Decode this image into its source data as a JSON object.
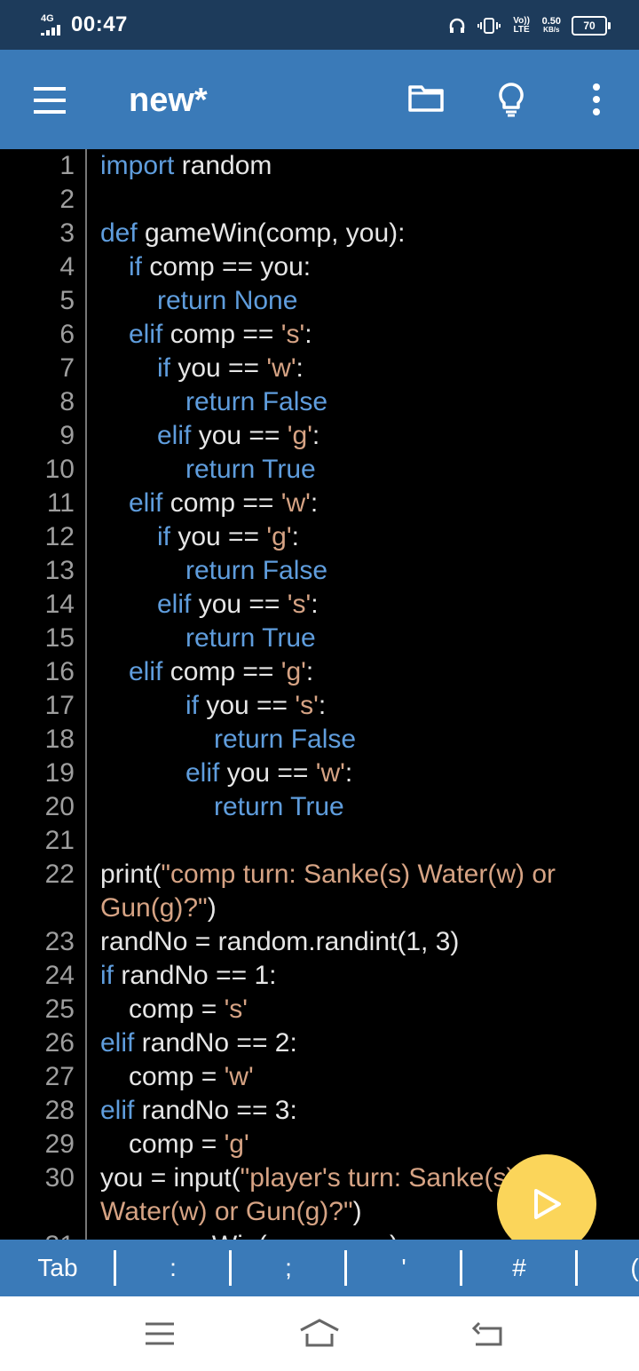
{
  "status": {
    "network_label": "4G",
    "time": "00:47",
    "volte": "Vo)) LTE",
    "speed_value": "0.50",
    "speed_unit": "KB/s",
    "battery": "70"
  },
  "app": {
    "title": "new*",
    "menu_icon": "hamburger-menu-icon",
    "open_icon": "folder-icon",
    "tip_icon": "lightbulb-icon",
    "more_icon": "more-vert-icon"
  },
  "editor": {
    "lines": [
      {
        "n": "1",
        "indent": 0,
        "tokens": [
          {
            "t": "import",
            "c": "kw"
          },
          {
            "t": " random",
            "c": ""
          }
        ]
      },
      {
        "n": "2",
        "indent": 0,
        "tokens": []
      },
      {
        "n": "3",
        "indent": 0,
        "tokens": [
          {
            "t": "def",
            "c": "kw"
          },
          {
            "t": " gameWin(comp, you):",
            "c": ""
          }
        ]
      },
      {
        "n": "4",
        "indent": 1,
        "tokens": [
          {
            "t": "if",
            "c": "kw"
          },
          {
            "t": " comp == you:",
            "c": ""
          }
        ]
      },
      {
        "n": "5",
        "indent": 2,
        "tokens": [
          {
            "t": "return None",
            "c": "kw"
          }
        ]
      },
      {
        "n": "6",
        "indent": 1,
        "tokens": [
          {
            "t": "elif",
            "c": "kw"
          },
          {
            "t": " comp == ",
            "c": ""
          },
          {
            "t": "'s'",
            "c": "str"
          },
          {
            "t": ":",
            "c": ""
          }
        ]
      },
      {
        "n": "7",
        "indent": 2,
        "tokens": [
          {
            "t": "if",
            "c": "kw"
          },
          {
            "t": " you == ",
            "c": ""
          },
          {
            "t": "'w'",
            "c": "str"
          },
          {
            "t": ":",
            "c": ""
          }
        ]
      },
      {
        "n": "8",
        "indent": 3,
        "tokens": [
          {
            "t": "return False",
            "c": "kw"
          }
        ]
      },
      {
        "n": "9",
        "indent": 2,
        "tokens": [
          {
            "t": "elif",
            "c": "kw"
          },
          {
            "t": " you == ",
            "c": ""
          },
          {
            "t": "'g'",
            "c": "str"
          },
          {
            "t": ":",
            "c": ""
          }
        ]
      },
      {
        "n": "10",
        "indent": 3,
        "tokens": [
          {
            "t": "return True",
            "c": "kw"
          }
        ]
      },
      {
        "n": "11",
        "indent": 1,
        "tokens": [
          {
            "t": "elif",
            "c": "kw"
          },
          {
            "t": " comp == ",
            "c": ""
          },
          {
            "t": "'w'",
            "c": "str"
          },
          {
            "t": ":",
            "c": ""
          }
        ]
      },
      {
        "n": "12",
        "indent": 2,
        "tokens": [
          {
            "t": "if",
            "c": "kw"
          },
          {
            "t": " you == ",
            "c": ""
          },
          {
            "t": "'g'",
            "c": "str"
          },
          {
            "t": ":",
            "c": ""
          }
        ]
      },
      {
        "n": "13",
        "indent": 3,
        "tokens": [
          {
            "t": "return False",
            "c": "kw"
          }
        ]
      },
      {
        "n": "14",
        "indent": 2,
        "tokens": [
          {
            "t": "elif",
            "c": "kw"
          },
          {
            "t": " you == ",
            "c": ""
          },
          {
            "t": "'s'",
            "c": "str"
          },
          {
            "t": ":",
            "c": ""
          }
        ]
      },
      {
        "n": "15",
        "indent": 3,
        "tokens": [
          {
            "t": "return True",
            "c": "kw"
          }
        ]
      },
      {
        "n": "16",
        "indent": 1,
        "tokens": [
          {
            "t": "elif",
            "c": "kw"
          },
          {
            "t": " comp == ",
            "c": ""
          },
          {
            "t": "'g'",
            "c": "str"
          },
          {
            "t": ":",
            "c": ""
          }
        ]
      },
      {
        "n": "17",
        "indent": 3,
        "tokens": [
          {
            "t": "if",
            "c": "kw"
          },
          {
            "t": " you == ",
            "c": ""
          },
          {
            "t": "'s'",
            "c": "str"
          },
          {
            "t": ":",
            "c": ""
          }
        ]
      },
      {
        "n": "18",
        "indent": 4,
        "tokens": [
          {
            "t": "return False",
            "c": "kw"
          }
        ]
      },
      {
        "n": "19",
        "indent": 3,
        "tokens": [
          {
            "t": "elif",
            "c": "kw"
          },
          {
            "t": " you == ",
            "c": ""
          },
          {
            "t": "'w'",
            "c": "str"
          },
          {
            "t": ":",
            "c": ""
          }
        ]
      },
      {
        "n": "20",
        "indent": 4,
        "tokens": [
          {
            "t": "return True",
            "c": "kw"
          }
        ]
      },
      {
        "n": "21",
        "indent": 0,
        "tokens": []
      },
      {
        "n": "22",
        "indent": 0,
        "tokens": [
          {
            "t": "print(",
            "c": ""
          },
          {
            "t": "\"comp turn: Sanke(s) Water(w) or",
            "c": "str"
          }
        ]
      },
      {
        "n": "",
        "indent": 0,
        "tokens": [
          {
            "t": "Gun(g)?\"",
            "c": "str"
          },
          {
            "t": ")",
            "c": ""
          }
        ]
      },
      {
        "n": "23",
        "indent": 0,
        "tokens": [
          {
            "t": "randNo = random.randint(1, 3)",
            "c": ""
          }
        ]
      },
      {
        "n": "24",
        "indent": 0,
        "tokens": [
          {
            "t": "if",
            "c": "kw"
          },
          {
            "t": " randNo == 1:",
            "c": ""
          }
        ]
      },
      {
        "n": "25",
        "indent": 1,
        "tokens": [
          {
            "t": "comp = ",
            "c": ""
          },
          {
            "t": "'s'",
            "c": "str"
          }
        ]
      },
      {
        "n": "26",
        "indent": 0,
        "tokens": [
          {
            "t": "elif",
            "c": "kw"
          },
          {
            "t": " randNo == 2:",
            "c": ""
          }
        ]
      },
      {
        "n": "27",
        "indent": 1,
        "tokens": [
          {
            "t": "comp = ",
            "c": ""
          },
          {
            "t": "'w'",
            "c": "str"
          }
        ]
      },
      {
        "n": "28",
        "indent": 0,
        "tokens": [
          {
            "t": "elif",
            "c": "kw"
          },
          {
            "t": " randNo == 3:",
            "c": ""
          }
        ]
      },
      {
        "n": "29",
        "indent": 1,
        "tokens": [
          {
            "t": "comp = ",
            "c": ""
          },
          {
            "t": "'g'",
            "c": "str"
          }
        ]
      },
      {
        "n": "30",
        "indent": 0,
        "tokens": [
          {
            "t": "you = input(",
            "c": ""
          },
          {
            "t": "\"player's turn: Sanke(s)",
            "c": "str"
          }
        ]
      },
      {
        "n": "",
        "indent": 0,
        "tokens": [
          {
            "t": "Water(w) or Gun(g)?\"",
            "c": "str"
          },
          {
            "t": ")",
            "c": ""
          }
        ]
      },
      {
        "n": "31",
        "indent": 0,
        "tokens": [
          {
            "t": "a = gameWin(comp, you)",
            "c": ""
          }
        ]
      }
    ]
  },
  "run_button": {
    "icon": "play-icon"
  },
  "keys": [
    "Tab",
    ":",
    ";",
    "'",
    "#",
    "("
  ],
  "navbar": {
    "menu": "recent-apps-icon",
    "home": "home-icon",
    "back": "back-icon"
  },
  "colors": {
    "appbar": "#3a7ab8",
    "statusbar": "#1d3b5b",
    "keyword": "#5f9ddd",
    "string": "#d6a384",
    "fab": "#fbd55a"
  }
}
